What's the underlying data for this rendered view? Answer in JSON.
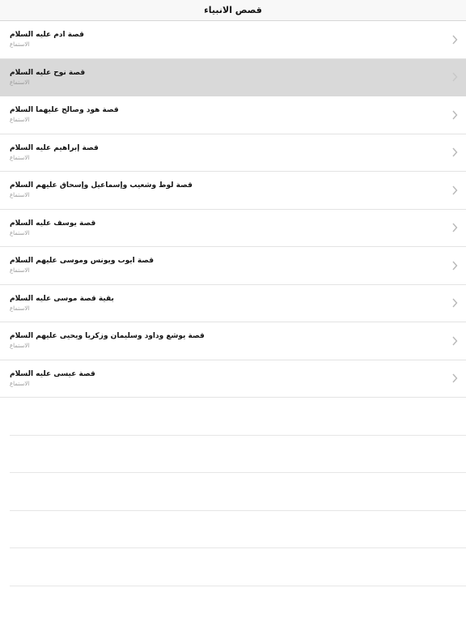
{
  "navbar": {
    "title": "قصص الانبياء"
  },
  "list": {
    "subtitle": "الاستماع",
    "items": [
      {
        "title": "قصة ادم عليه السلام",
        "subtitle": "الاستماع",
        "selected": false
      },
      {
        "title": "قصة نوح عليه السلام",
        "subtitle": "الاستماع",
        "selected": true
      },
      {
        "title": "قصة هود وصالح عليهما السلام",
        "subtitle": "الاستماع",
        "selected": false
      },
      {
        "title": "قصة إبراهيم عليه السلام",
        "subtitle": "الاستماع",
        "selected": false
      },
      {
        "title": "قصة لوط وشعيب وإسماعيل وإسحاق عليهم السلام",
        "subtitle": "الاستماع",
        "selected": false
      },
      {
        "title": "قصة يوسف عليه السلام",
        "subtitle": "الاستماع",
        "selected": false
      },
      {
        "title": "قصة ايوب ويونس وموسى عليهم السلام",
        "subtitle": "الاستماع",
        "selected": false
      },
      {
        "title": "بقية قصة موسى عليه السلام",
        "subtitle": "الاستماع",
        "selected": false
      },
      {
        "title": "قصة يوشع وداود وسليمان وزكريا ويحيى عليهم السلام",
        "subtitle": "الاستماع",
        "selected": false
      },
      {
        "title": "قصة عيسى عليه السلام",
        "subtitle": "الاستماع",
        "selected": false
      }
    ]
  },
  "icons": {
    "row_accessory": "chevron-right-icon"
  },
  "colors": {
    "selected_row": "#d9d9d9",
    "chevron": "#b8b8b8",
    "subtitle": "#9a9a9a"
  }
}
